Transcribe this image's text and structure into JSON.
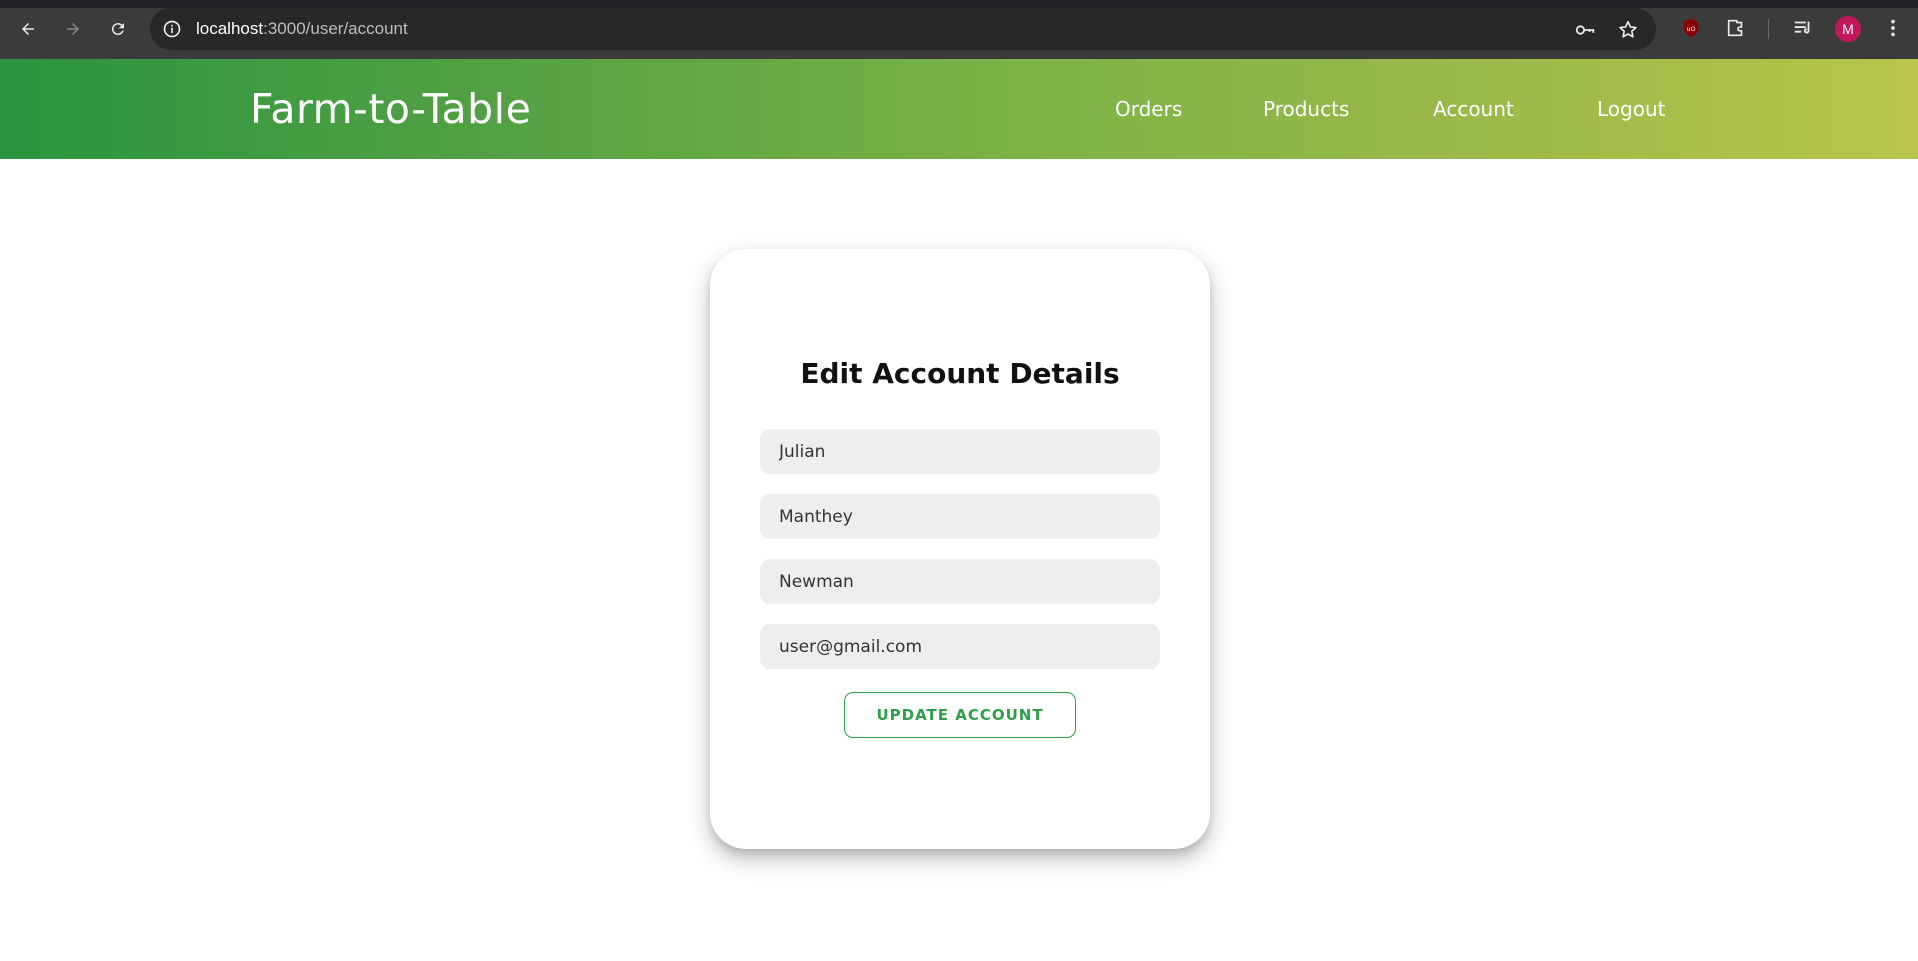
{
  "browser": {
    "url_host": "localhost",
    "url_rest": ":3000/user/account",
    "profile_initial": "M"
  },
  "header": {
    "brand": "Farm-to-Table",
    "nav": [
      "Orders",
      "Products",
      "Account",
      "Logout"
    ]
  },
  "form": {
    "title": "Edit Account Details",
    "first_name": "Julian",
    "middle_name": "Manthey",
    "last_name": "Newman",
    "email": "user@gmail.com",
    "submit_label": "UPDATE ACCOUNT"
  },
  "colors": {
    "accent": "#2e9e47",
    "header_gradient_start": "#2a9440",
    "header_gradient_end": "#b9c54c"
  }
}
